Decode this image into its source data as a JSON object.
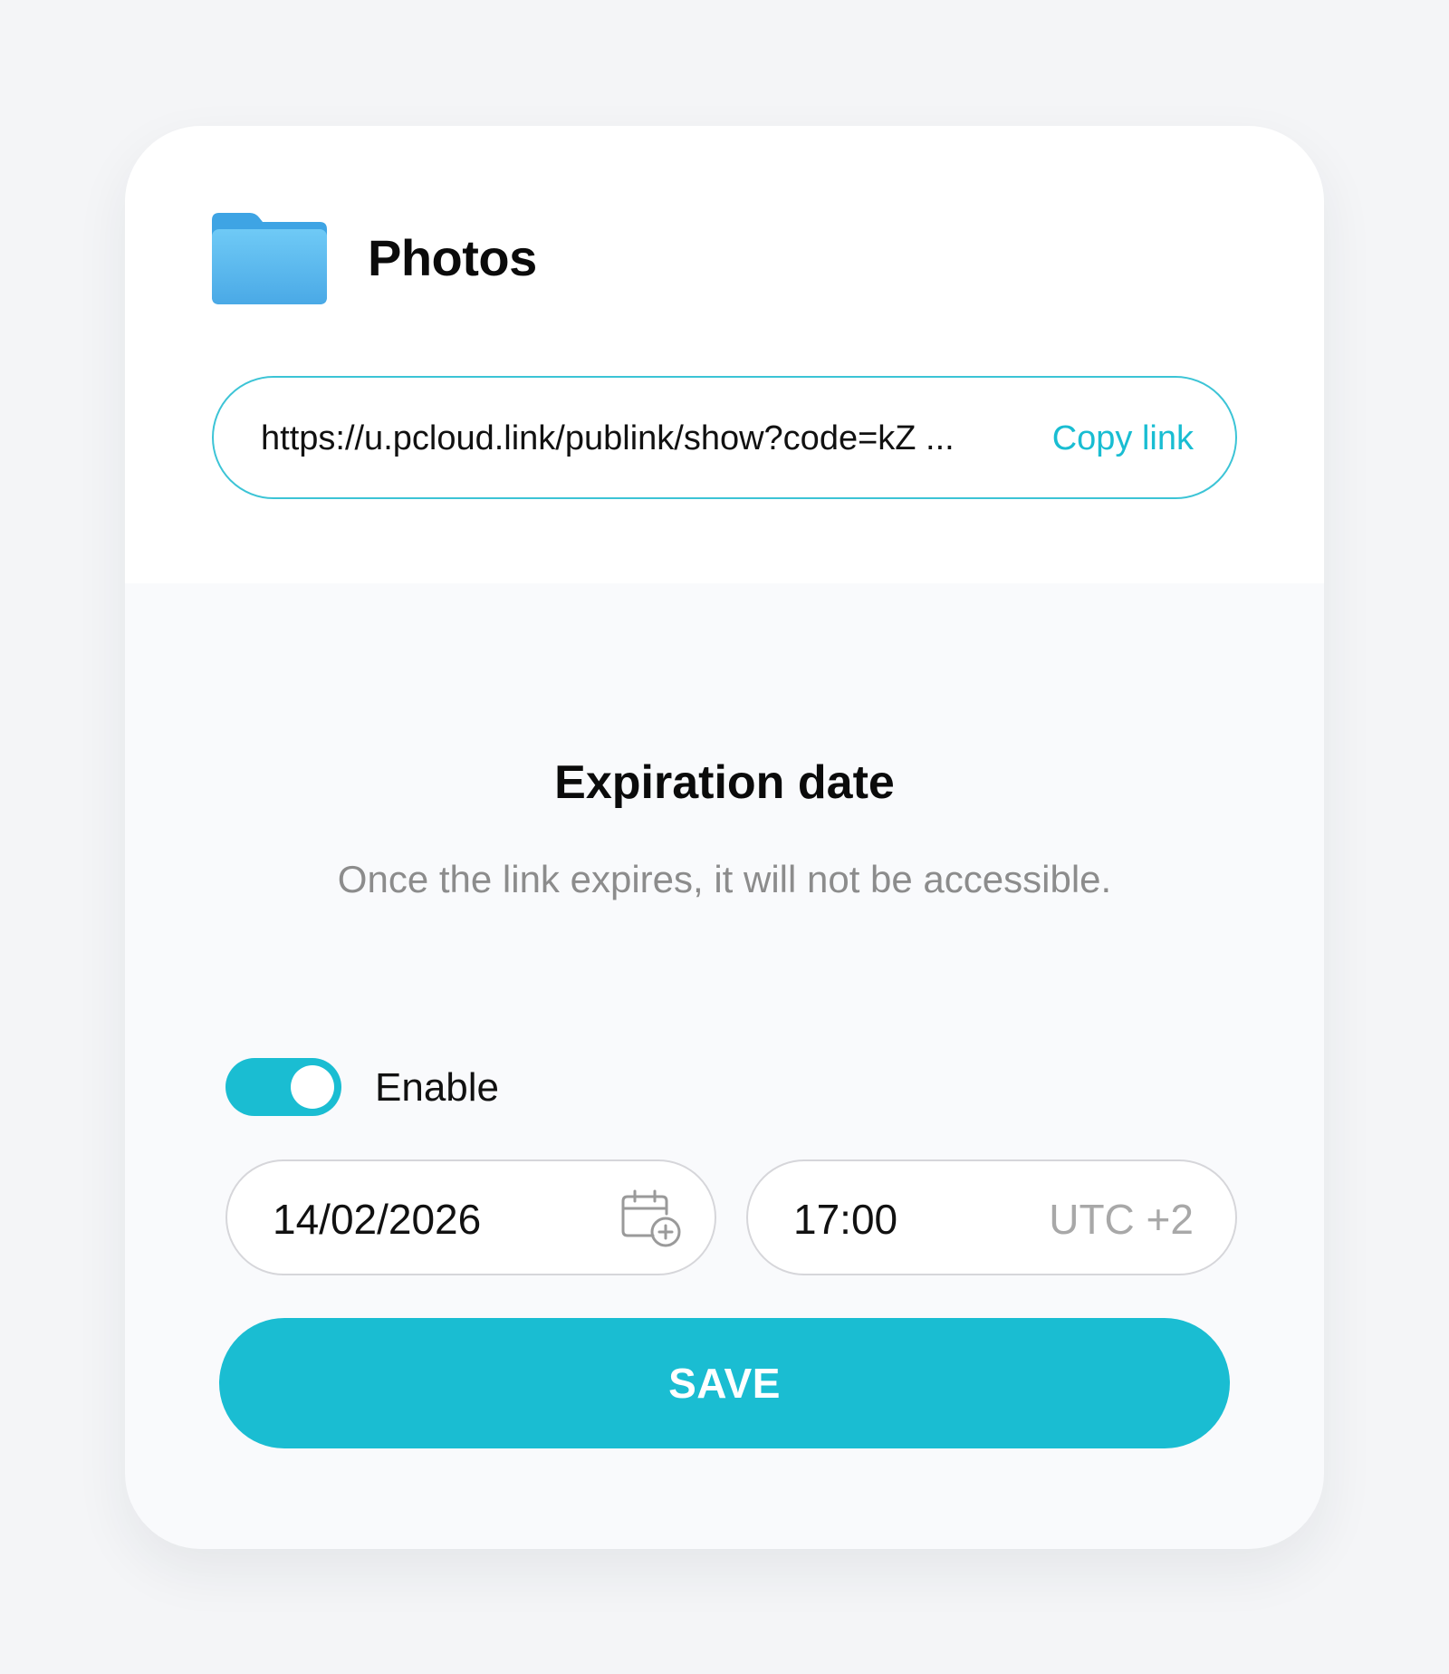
{
  "folder": {
    "icon": "folder-icon",
    "title": "Photos",
    "color": "#5bb8ee"
  },
  "share_link": {
    "url": "https://u.pcloud.link/publink/show?code=kZ ...",
    "copy_label": "Copy link"
  },
  "expiration": {
    "title": "Expiration date",
    "description": "Once the link expires, it will not be accessible.",
    "toggle": {
      "label": "Enable",
      "enabled": true
    },
    "date": {
      "value": "14/02/2026",
      "icon": "calendar-add-icon"
    },
    "time": {
      "value": "17:00",
      "timezone": "UTC +2"
    }
  },
  "actions": {
    "save_label": "SAVE"
  },
  "colors": {
    "accent": "#1abdd2",
    "background": "#f4f5f7"
  }
}
